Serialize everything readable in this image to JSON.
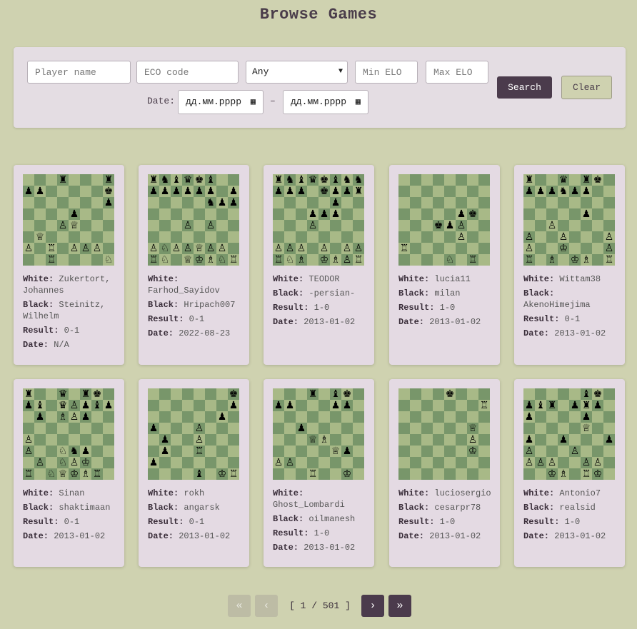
{
  "page_title": "Browse Games",
  "filters": {
    "player_placeholder": "Player name",
    "eco_placeholder": "ECO code",
    "result_selected": "Any",
    "min_elo_placeholder": "Min ELO",
    "max_elo_placeholder": "Max ELO",
    "date_label": "Date:",
    "date_from_value": "дд.мм.рррр",
    "date_to_value": "дд.мм.рррр",
    "date_separator": "–",
    "search_label": "Search",
    "clear_label": "Clear"
  },
  "labels": {
    "white": "White:",
    "black": "Black:",
    "result": "Result:",
    "date": "Date:"
  },
  "games": [
    {
      "white": "Zukertort, Johannes",
      "black": "Steinitz, Wilhelm",
      "result": "0-1",
      "date": "N/A"
    },
    {
      "white": "Farhod_Sayidov",
      "black": "Hripach007",
      "result": "0-1",
      "date": "2022-08-23"
    },
    {
      "white": "TEODOR",
      "black": "-persian-",
      "result": "1-0",
      "date": "2013-01-02"
    },
    {
      "white": "lucia11",
      "black": "milan",
      "result": "1-0",
      "date": "2013-01-02"
    },
    {
      "white": "Wittam38",
      "black": "AkenoHimejima",
      "result": "0-1",
      "date": "2013-01-02"
    },
    {
      "white": "Sinan",
      "black": "shaktimaan",
      "result": "0-1",
      "date": "2013-01-02"
    },
    {
      "white": "rokh",
      "black": "angarsk",
      "result": "0-1",
      "date": "2013-01-02"
    },
    {
      "white": "Ghost_Lombardi",
      "black": "oilmanesh",
      "result": "1-0",
      "date": "2013-01-02"
    },
    {
      "white": "luciosergio",
      "black": "cesarpr78",
      "result": "1-0",
      "date": "2013-01-02"
    },
    {
      "white": "Antonio7",
      "black": "realsid",
      "result": "1-0",
      "date": "2013-01-02"
    }
  ],
  "boards": [
    "3r3r/pp5k/7p/4p3/3PQ3/1Q6/P1R1PPP1/2R4N",
    "rnbqkb2/pppppp1p/5npp/8/3P1P2/8/PNPPQPP1/RN1QKBNR",
    "rnbqkbnn/ppp1kppr/5p2/3ppp2/3P4/8/PPP1P1PP/RNB1KBPR",
    "8/8/8/5pk1/3kpP2/5P2/R7/4N1R1",
    "r2q1rk1/pppnpp2/8/5p2/2P5/P2P3P/P2K3P/R1B1KB1R",
    "r2q1rk1/pb1qPpbp/1p1BPp2/8/P7/P2Nnp2/1P1NPK2/R1NQKBR1",
    "7k/7p/6p1/p3P3/1p2P3/1p2R3/p7/4b1KR",
    "3r1bk1/pp3pp1/8/2p5/3QB3/5Qp1/PP6/3R2K1",
    "4k3/7R/8/6Q1/6P1/6K1/8/8",
    "5bk1/pbr1prp1/p4p2/5Q2/p2p3p/P3P3/PPP2PP1/2KB1RK1"
  ],
  "pagination": {
    "first": "«",
    "prev": "‹",
    "page_text": "[ 1 / 501 ]",
    "next": "›",
    "last": "»"
  }
}
